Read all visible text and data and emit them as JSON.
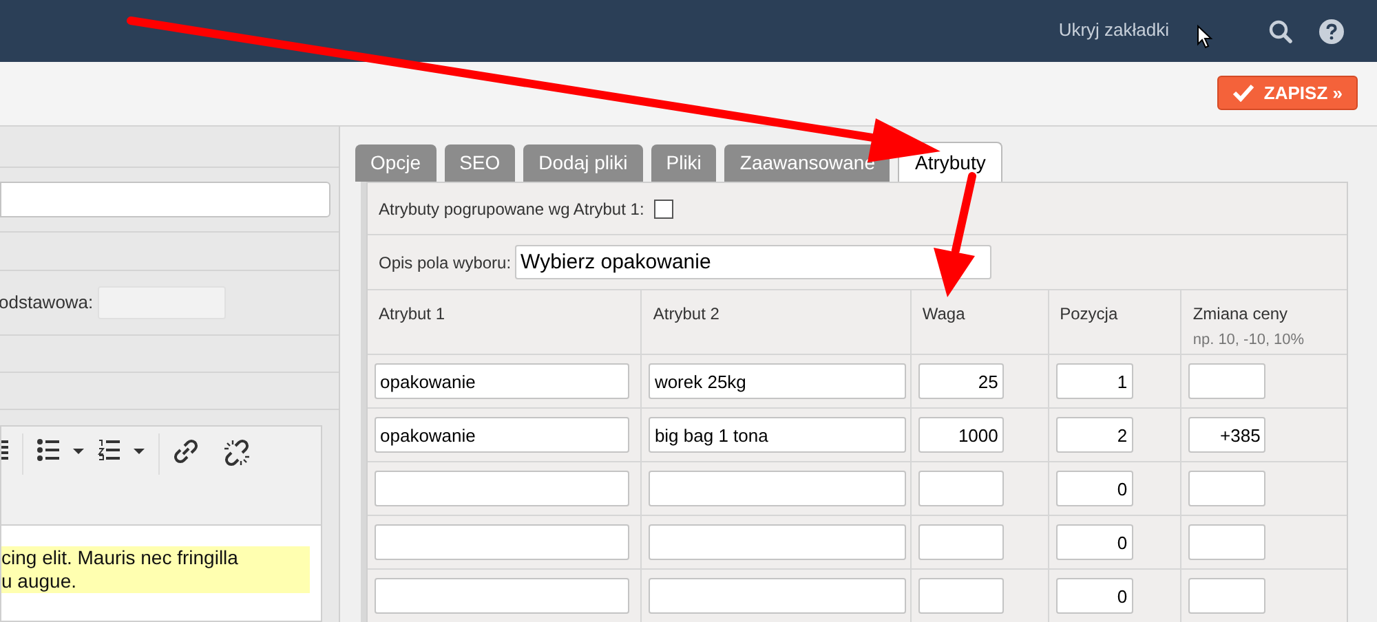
{
  "header": {
    "hide_tabs_link": "Ukryj zakładki"
  },
  "toolbar": {
    "save_button": "ZAPISZ »"
  },
  "left_panel": {
    "field_label": "odstawowa:",
    "editor_lines": [
      "cing elit. Mauris nec fringilla",
      "u augue."
    ]
  },
  "tabs": [
    {
      "label": "Opcje",
      "selected": false
    },
    {
      "label": "SEO",
      "selected": false
    },
    {
      "label": "Dodaj pliki",
      "selected": false
    },
    {
      "label": "Pliki",
      "selected": false
    },
    {
      "label": "Zaawansowane",
      "selected": false
    },
    {
      "label": "Atrybuty",
      "selected": true
    }
  ],
  "attributes": {
    "grouped_label": "Atrybuty pogrupowane wg Atrybut 1:",
    "grouped_checked": false,
    "choice_label": "Opis pola wyboru:",
    "choice_value": "Wybierz opakowanie",
    "columns": [
      {
        "label": "Atrybut 1"
      },
      {
        "label": "Atrybut 2"
      },
      {
        "label": "Waga"
      },
      {
        "label": "Pozycja"
      },
      {
        "label": "Zmiana ceny",
        "hint": "np. 10, -10, 10%"
      }
    ],
    "rows": [
      {
        "atrybut_1": "opakowanie",
        "atrybut_2": "worek 25kg",
        "waga": "25",
        "pozycja": "1"
      },
      {
        "atrybut_1": "opakowanie",
        "atrybut_2": "big bag 1 tona",
        "waga": "1000",
        "pozycja": "2",
        "zmiana_ceny": "+385"
      },
      {
        "pozycja": "0"
      },
      {
        "pozycja": "0"
      },
      {
        "pozycja": "0"
      }
    ]
  }
}
